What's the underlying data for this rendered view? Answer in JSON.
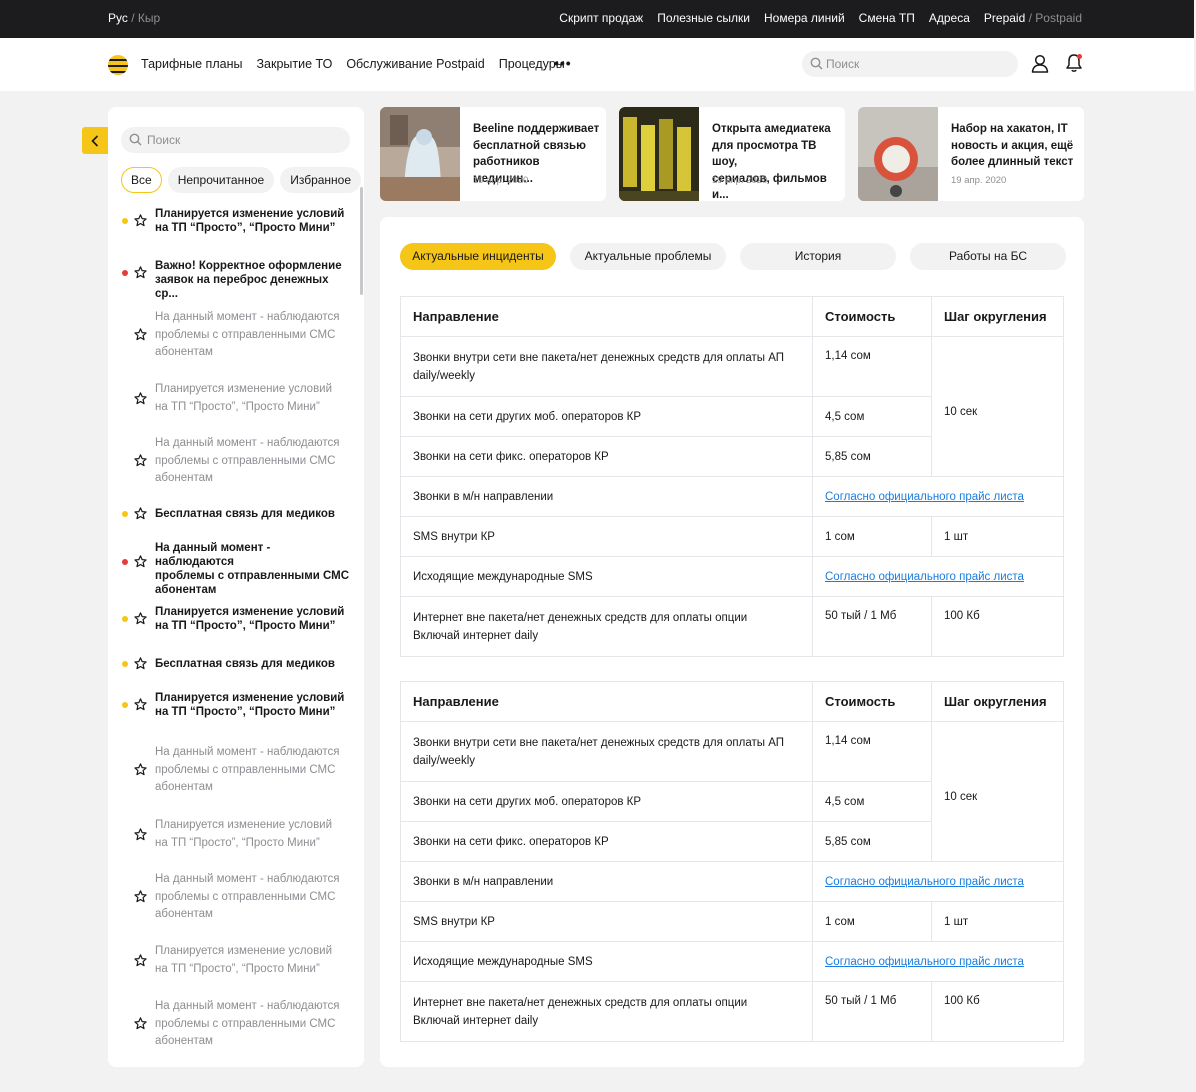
{
  "topbar": {
    "lang_active": "Рус",
    "lang_sep": "/",
    "lang_inactive": "Кыр",
    "links": [
      "Скрипт продаж",
      "Полезные сылки",
      "Номера линий",
      "Смена ТП",
      "Адреса"
    ],
    "mode_active": "Prepaid",
    "mode_sep": "/",
    "mode_inactive": "Postpaid"
  },
  "header": {
    "nav": [
      "Тарифные планы",
      "Закрытие ТО",
      "Обслуживание Postpaid",
      "Процедуры"
    ],
    "more": "•••",
    "search_placeholder": "Поиск"
  },
  "sidebar": {
    "search_placeholder": "Поиск",
    "filters": [
      "Все",
      "Непрочитанное",
      "Избранное"
    ],
    "items": [
      {
        "status": "yellow",
        "unread": true,
        "lines": [
          "Планируется изменение условий",
          "на ТП “Просто”, “Просто Мини”"
        ]
      },
      {
        "status": "red",
        "unread": true,
        "lines": [
          "Важно! Корректное оформление",
          "заявок на переброс денежных ср..."
        ]
      },
      {
        "status": "none",
        "unread": false,
        "lines": [
          "На данный момент - наблюдаются",
          "проблемы с отправленными СМС",
          "абонентам"
        ]
      },
      {
        "status": "none",
        "unread": false,
        "lines": [
          "Планируется изменение условий",
          "на ТП “Просто”, “Просто Мини”"
        ]
      },
      {
        "status": "none",
        "unread": false,
        "lines": [
          "На данный момент - наблюдаются",
          "проблемы с отправленными СМС",
          "абонентам"
        ]
      },
      {
        "status": "yellow",
        "unread": true,
        "lines": [
          "Бесплатная связь для медиков"
        ]
      },
      {
        "status": "red",
        "unread": true,
        "lines": [
          "На данный момент - наблюдаются",
          "проблемы с отправленными СМС",
          "абонентам"
        ]
      },
      {
        "status": "yellow",
        "unread": true,
        "lines": [
          "Планируется изменение условий",
          "на ТП “Просто”, “Просто Мини”"
        ]
      },
      {
        "status": "yellow",
        "unread": true,
        "lines": [
          "Бесплатная связь для медиков"
        ]
      },
      {
        "status": "yellow",
        "unread": true,
        "lines": [
          "Планируется изменение условий",
          "на ТП “Просто”, “Просто Мини”"
        ]
      },
      {
        "status": "none",
        "unread": false,
        "lines": [
          "На данный момент - наблюдаются",
          "проблемы с отправленными СМС",
          "абонентам"
        ]
      },
      {
        "status": "none",
        "unread": false,
        "lines": [
          "Планируется изменение условий",
          "на ТП “Просто”, “Просто Мини”"
        ]
      },
      {
        "status": "none",
        "unread": false,
        "lines": [
          "На данный момент - наблюдаются",
          "проблемы с отправленными СМС",
          "абонентам"
        ]
      },
      {
        "status": "none",
        "unread": false,
        "lines": [
          "Планируется изменение условий",
          "на ТП “Просто”, “Просто Мини”"
        ]
      },
      {
        "status": "none",
        "unread": false,
        "lines": [
          "На данный момент - наблюдаются",
          "проблемы с отправленными СМС",
          "абонентам"
        ]
      }
    ]
  },
  "news": [
    {
      "lines": [
        "Beeline поддерживает",
        "бесплатной связью",
        "работников медицин..."
      ],
      "date": "19 апр. 2020"
    },
    {
      "lines": [
        "Открыта амедиатека",
        "для просмотра ТВ шоу,",
        "сериалов, фильмов и..."
      ],
      "date": "19 апр. 2020"
    },
    {
      "lines": [
        "Набор на хакатон, IT",
        "новость и акция, ещё",
        "более длинный текст"
      ],
      "date": "19 апр. 2020"
    }
  ],
  "tabs": [
    "Актуальные инциденты",
    "Актуальные проблемы",
    "История",
    "Работы на БС"
  ],
  "table": {
    "headers": [
      "Направление",
      "Стоимость",
      "Шаг округления"
    ],
    "rows": [
      {
        "lines": [
          "Звонки внутри сети вне пакета/нет денежных средств для оплаты АП",
          "daily/weekly"
        ],
        "cost": "1,14 сом"
      },
      {
        "lines": [
          "Звонки на сети других моб. операторов КР"
        ],
        "cost": "4,5 сом"
      },
      {
        "lines": [
          "Звонки на сети фикс. операторов КР"
        ],
        "cost": "5,85 сом"
      },
      {
        "lines": [
          "Звонки в м/н направлении"
        ],
        "link": "Согласно официального прайс листа"
      },
      {
        "lines": [
          "SMS внутри КР"
        ],
        "cost": "1 сом",
        "step": "1 шт"
      },
      {
        "lines": [
          "Исходящие международные SMS"
        ],
        "link": "Согласно официального прайс листа"
      },
      {
        "lines": [
          "Интернет вне пакета/нет денежных средств для оплаты опции",
          "Включай интернет daily"
        ],
        "cost": "50 тый / 1 Мб",
        "step": "100 Кб"
      }
    ],
    "merged_step": "10 сек"
  },
  "colors": {
    "accent": "#f5c518",
    "dark": "#1c1c1e",
    "unread_yellow": "#f5c518",
    "unread_red": "#e63b3b",
    "link": "#1a7ddf"
  },
  "icons": [
    "search-icon",
    "user-icon",
    "bell-icon",
    "chevron-left-icon",
    "star-icon"
  ]
}
